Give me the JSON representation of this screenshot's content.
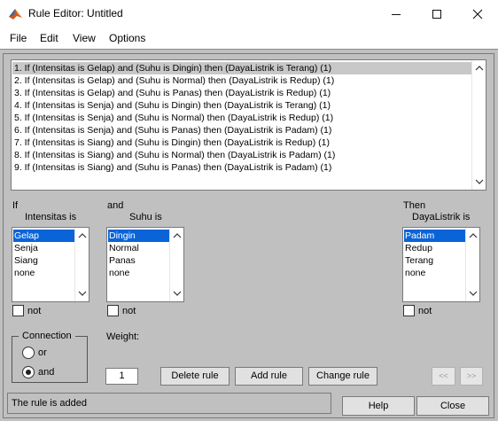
{
  "window": {
    "title": "Rule Editor: Untitled",
    "app_icon": "matlab-logo-icon",
    "minimize_icon": "minimize-icon",
    "maximize_icon": "maximize-icon",
    "close_icon": "close-icon"
  },
  "menu": [
    "File",
    "Edit",
    "View",
    "Options"
  ],
  "rules": [
    "1. If (Intensitas is Gelap) and (Suhu is Dingin) then (DayaListrik is Terang) (1)",
    "2. If (Intensitas is Gelap) and (Suhu is Normal) then (DayaListrik is Redup) (1)",
    "3. If (Intensitas is Gelap) and (Suhu is Panas) then (DayaListrik is Redup) (1)",
    "4. If (Intensitas is Senja) and (Suhu is Dingin) then (DayaListrik is Terang) (1)",
    "5. If (Intensitas is Senja) and (Suhu is Normal) then (DayaListrik is Redup) (1)",
    "6. If (Intensitas is Senja) and (Suhu is Panas) then (DayaListrik is Padam) (1)",
    "7. If (Intensitas is Siang) and (Suhu is Dingin) then (DayaListrik is Redup) (1)",
    "8. If (Intensitas is Siang) and (Suhu is Normal) then (DayaListrik is Padam) (1)",
    "9. If (Intensitas is Siang) and (Suhu is Panas) then (DayaListrik is Padam) (1)"
  ],
  "selected_rule": 0,
  "if_block": {
    "keyword": "If",
    "variable_label": "Intensitas is",
    "options": [
      "Gelap",
      "Senja",
      "Siang",
      "none"
    ],
    "selected": 0,
    "not_label": "not"
  },
  "and_block": {
    "keyword": "and",
    "variable_label": "Suhu is",
    "options": [
      "Dingin",
      "Normal",
      "Panas",
      "none"
    ],
    "selected": 0,
    "not_label": "not"
  },
  "then_block": {
    "keyword": "Then",
    "variable_label": "DayaListrik is",
    "options": [
      "Padam",
      "Redup",
      "Terang",
      "none"
    ],
    "selected": 0,
    "not_label": "not"
  },
  "connection": {
    "title": "Connection",
    "or_label": "or",
    "and_label": "and",
    "selected": "and"
  },
  "weight": {
    "label": "Weight:",
    "value": "1"
  },
  "buttons": {
    "delete": "Delete rule",
    "add": "Add rule",
    "change": "Change rule",
    "prev": "<<",
    "next": ">>",
    "help": "Help",
    "close": "Close"
  },
  "status": "The rule is added",
  "colors": {
    "panel": "#c0c0c0",
    "list_selection": "#0a64d8",
    "rule_selection": "#c8c8c8"
  }
}
